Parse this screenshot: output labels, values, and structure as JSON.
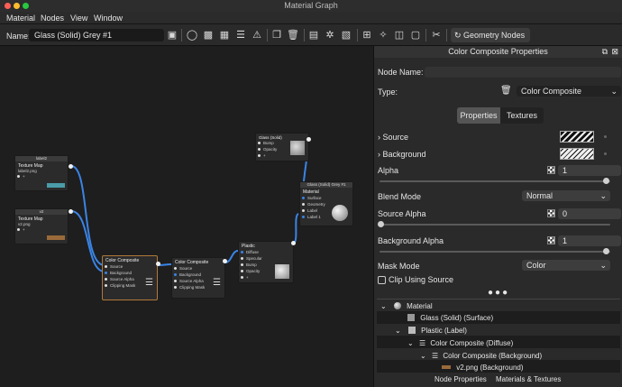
{
  "window": {
    "title": "Material Graph"
  },
  "menu": [
    "Material",
    "Nodes",
    "View",
    "Window"
  ],
  "toolbar": {
    "name_label": "Name:",
    "name_value": "Glass (Solid) Grey #1",
    "geometry_button": "Geometry Nodes"
  },
  "nodes": {
    "tex1": {
      "tag": "label2",
      "title": "Texture Map",
      "file": "label2.png"
    },
    "tex2": {
      "tag": "v2",
      "title": "Texture Map",
      "file": "v2.png"
    },
    "cc1": {
      "title": "Color Composite",
      "rows": [
        "Source",
        "Background",
        "Source Alpha",
        "Clipping Mask"
      ]
    },
    "cc2": {
      "title": "Color Composite",
      "rows": [
        "Source",
        "Background",
        "Source Alpha",
        "Clipping Mask"
      ]
    },
    "glass": {
      "title": "Glass (Solid)",
      "rows": [
        "Bump",
        "Opacity",
        "+"
      ]
    },
    "plastic": {
      "title": "Plastic",
      "rows": [
        "Diffuse",
        "Specular",
        "Bump",
        "Opacity",
        "+"
      ]
    },
    "material": {
      "tag": "Glass (Solid) Grey #1",
      "title": "Material",
      "rows": [
        "Surface",
        "Geometry",
        "Label",
        "Label 1"
      ]
    }
  },
  "panel": {
    "title": "Color Composite Properties",
    "node_name_label": "Node Name:",
    "node_name_value": "",
    "type_label": "Type:",
    "type_value": "Color Composite",
    "tabs": [
      "Properties",
      "Textures"
    ],
    "source_label": "Source",
    "background_label": "Background",
    "alpha_label": "Alpha",
    "alpha_value": "1",
    "blend_mode_label": "Blend Mode",
    "blend_mode_value": "Normal",
    "source_alpha_label": "Source Alpha",
    "source_alpha_value": "0",
    "background_alpha_label": "Background Alpha",
    "background_alpha_value": "1",
    "mask_mode_label": "Mask Mode",
    "mask_mode_value": "Color",
    "clip_label": "Clip Using Source"
  },
  "tree": [
    "Material",
    "Glass (Solid) (Surface)",
    "Plastic (Label)",
    "Color Composite (Diffuse)",
    "Color Composite (Background)",
    "v2.png (Background)"
  ],
  "bottom_tabs": [
    "Node Properties",
    "Materials & Textures"
  ],
  "colors": {
    "accent": "#3a84e6",
    "panel_bg": "#2a2a2a",
    "canvas_bg": "#1e1e1e"
  }
}
